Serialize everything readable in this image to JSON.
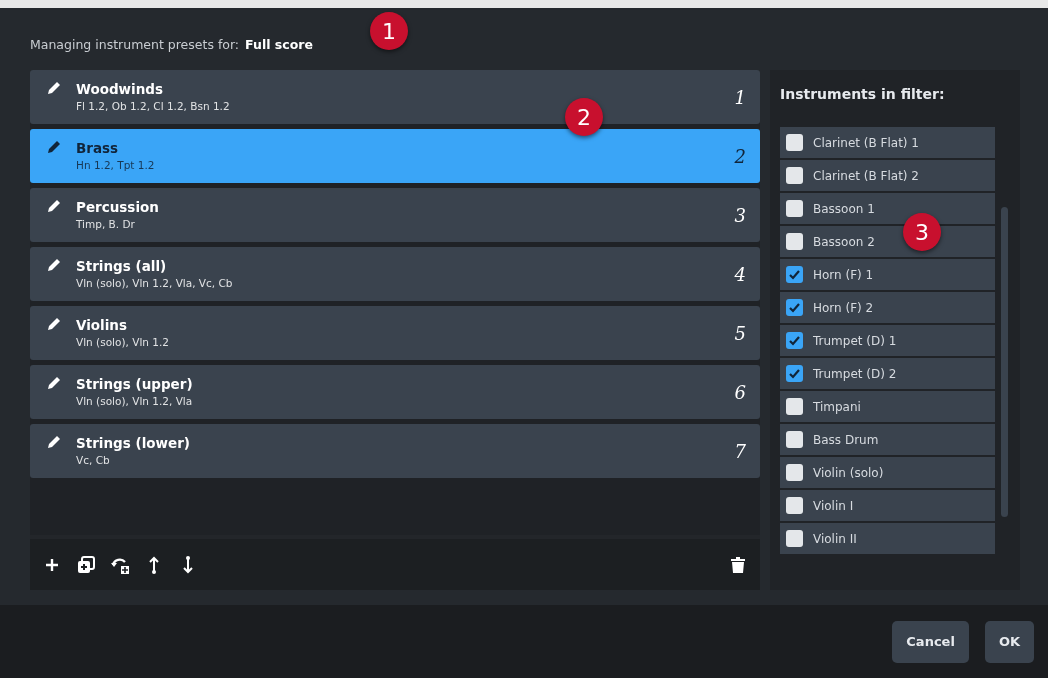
{
  "header": {
    "label": "Managing instrument presets for:",
    "value": "Full score"
  },
  "presets": [
    {
      "name": "Woodwinds",
      "instruments": "Fl 1.2, Ob 1.2, Cl 1.2, Bsn 1.2",
      "number": "1",
      "selected": false
    },
    {
      "name": "Brass",
      "instruments": "Hn 1.2, Tpt 1.2",
      "number": "2",
      "selected": true
    },
    {
      "name": "Percussion",
      "instruments": "Timp, B. Dr",
      "number": "3",
      "selected": false
    },
    {
      "name": "Strings (all)",
      "instruments": "Vln (solo), Vln 1.2, Vla, Vc, Cb",
      "number": "4",
      "selected": false
    },
    {
      "name": "Violins",
      "instruments": "Vln (solo), Vln 1.2",
      "number": "5",
      "selected": false
    },
    {
      "name": "Strings (upper)",
      "instruments": "Vln (solo), Vln 1.2, Vla",
      "number": "6",
      "selected": false
    },
    {
      "name": "Strings (lower)",
      "instruments": "Vc, Cb",
      "number": "7",
      "selected": false
    }
  ],
  "filter": {
    "title": "Instruments in filter:",
    "items": [
      {
        "label": "Clarinet (B Flat) 1",
        "checked": false
      },
      {
        "label": "Clarinet (B Flat) 2",
        "checked": false
      },
      {
        "label": "Bassoon 1",
        "checked": false
      },
      {
        "label": "Bassoon 2",
        "checked": false
      },
      {
        "label": "Horn (F) 1",
        "checked": true
      },
      {
        "label": "Horn (F) 2",
        "checked": true
      },
      {
        "label": "Trumpet (D) 1",
        "checked": true
      },
      {
        "label": "Trumpet (D) 2",
        "checked": true
      },
      {
        "label": "Timpani",
        "checked": false
      },
      {
        "label": "Bass Drum",
        "checked": false
      },
      {
        "label": "Violin (solo)",
        "checked": false
      },
      {
        "label": "Violin I",
        "checked": false
      },
      {
        "label": "Violin II",
        "checked": false
      }
    ]
  },
  "callouts": [
    "1",
    "2",
    "3"
  ],
  "buttons": [
    "Cancel",
    "OK"
  ]
}
